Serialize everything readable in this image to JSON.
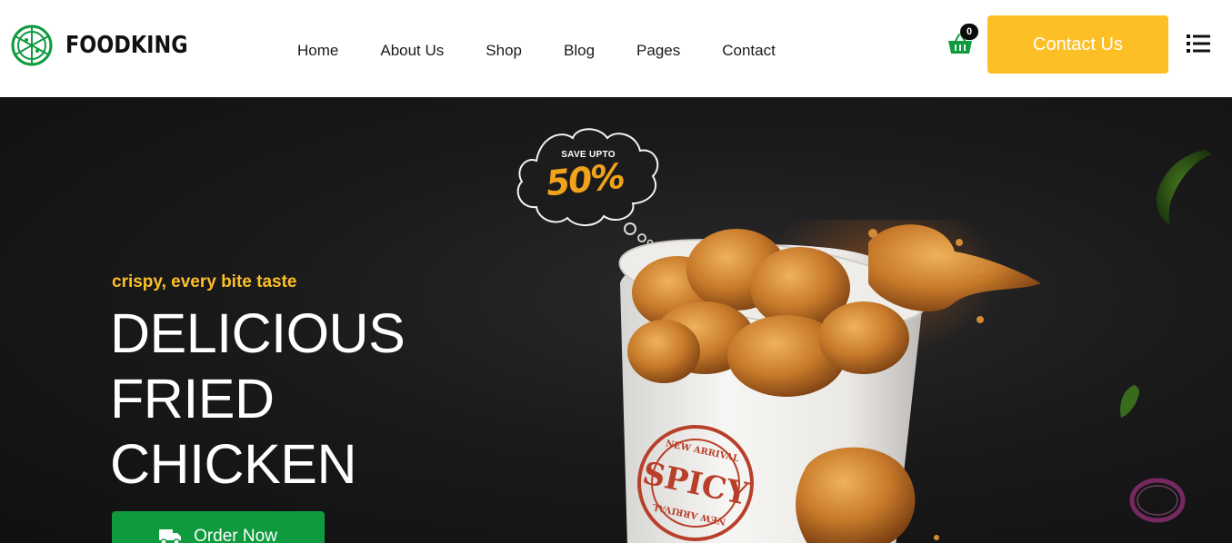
{
  "brand": {
    "name": "FOODKING",
    "accent": "#0f9a3e",
    "highlight": "#fcbf26"
  },
  "nav": {
    "items": [
      {
        "label": "Home"
      },
      {
        "label": "About Us"
      },
      {
        "label": "Shop"
      },
      {
        "label": "Blog"
      },
      {
        "label": "Pages"
      },
      {
        "label": "Contact"
      }
    ]
  },
  "header": {
    "cart_count": "0",
    "contact_label": "Contact Us",
    "icons": {
      "cart": "shopping-basket-icon",
      "menu": "list-menu-icon"
    }
  },
  "hero": {
    "subtitle": "crispy, every bite taste",
    "title_lines": [
      "DELICIOUS",
      "FRIED",
      "CHICKEN"
    ],
    "order_label": "Order Now",
    "order_icon": "delivery-truck-icon",
    "promo": {
      "line1": "SAVE UPTO",
      "value": "50%"
    },
    "bucket_stamp": {
      "top_text": "NEW ARRIVAL",
      "main_text": "SPICY",
      "bottom_text": "NEW ARRIVAL"
    }
  }
}
